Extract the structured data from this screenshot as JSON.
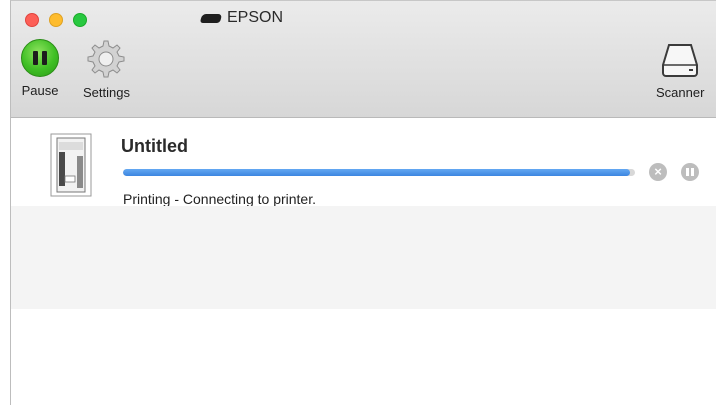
{
  "window": {
    "title": "EPSON",
    "title_icon": "printer-icon"
  },
  "toolbar": {
    "pause_label": "Pause",
    "settings_label": "Settings",
    "scanner_label": "Scanner"
  },
  "jobs": [
    {
      "name": "Untitled",
      "status": "Printing - Connecting to printer.",
      "progress": 0.99,
      "icon": "document-icon"
    }
  ],
  "colors": {
    "pause_green": "#3fbf25",
    "progress_blue": "#4a90e2",
    "close": "#fd5f57",
    "minimize": "#febc2e",
    "maximize": "#28c840"
  }
}
